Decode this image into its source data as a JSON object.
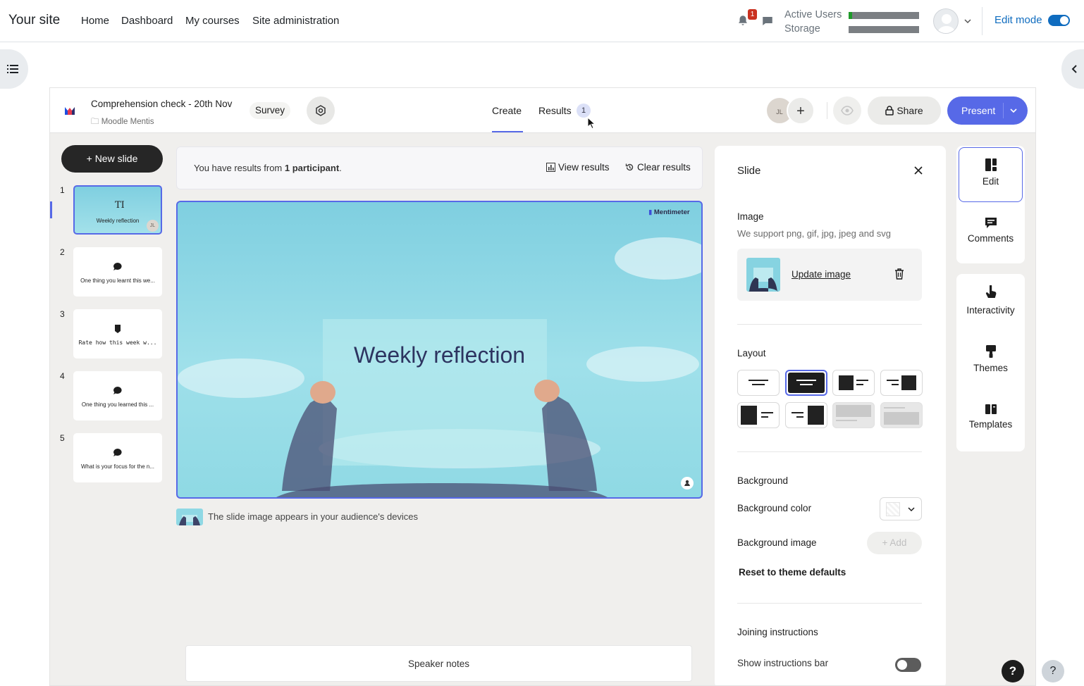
{
  "topnav": {
    "site_name": "Your site",
    "links": [
      "Home",
      "Dashboard",
      "My courses",
      "Site administration"
    ],
    "notification_count": "1",
    "active_users_label": "Active Users",
    "storage_label": "Storage",
    "active_users_fraction": 0.05,
    "edit_mode_label": "Edit mode",
    "edit_mode_on": true
  },
  "app": {
    "presentation_title": "Comprehension check - 20th Nov",
    "folder_name": "Moodle Mentis",
    "type_badge": "Survey",
    "tabs": {
      "create": "Create",
      "results": "Results",
      "results_count": "1"
    },
    "collaborator_initials": "JL",
    "share_label": "Share",
    "present_label": "Present"
  },
  "slides": {
    "new_slide_label": "New slide",
    "items": [
      {
        "number": "1",
        "text": "Weekly reflection",
        "badge": "JL",
        "icon": "heading-icon"
      },
      {
        "number": "2",
        "text": "One thing you learnt this we...",
        "icon": "speech-bubble-icon"
      },
      {
        "number": "3",
        "text": "Rate how this week w...",
        "icon": "rating-icon"
      },
      {
        "number": "4",
        "text": "One thing you learned this ...",
        "icon": "speech-bubble-icon"
      },
      {
        "number": "5",
        "text": "What is your focus for the n...",
        "icon": "speech-bubble-icon"
      }
    ]
  },
  "results_bar": {
    "text_before": "You have results from ",
    "participants": "1 participant",
    "text_after": ".",
    "view_results": "View results",
    "clear_results": "Clear results"
  },
  "canvas": {
    "brand": "Mentimeter",
    "heading": "Weekly reflection",
    "caption": "The slide image appears in your audience's devices"
  },
  "speaker_notes_label": "Speaker notes",
  "panel": {
    "title": "Slide",
    "image_label": "Image",
    "image_support": "We support png, gif, jpg, jpeg and svg",
    "update_image": "Update image",
    "layout_label": "Layout",
    "background_label": "Background",
    "background_color_label": "Background color",
    "background_image_label": "Background image",
    "add_label": "Add",
    "reset_label": "Reset to theme defaults",
    "joining_label": "Joining instructions",
    "show_bar_label": "Show instructions bar",
    "show_bar_on": false
  },
  "rail": {
    "edit": "Edit",
    "comments": "Comments",
    "interactivity": "Interactivity",
    "themes": "Themes",
    "templates": "Templates"
  },
  "help_label": "?",
  "colors": {
    "accent": "#5769e7",
    "moodle_blue": "#0f6cbf",
    "badge_red": "#ca3120"
  }
}
